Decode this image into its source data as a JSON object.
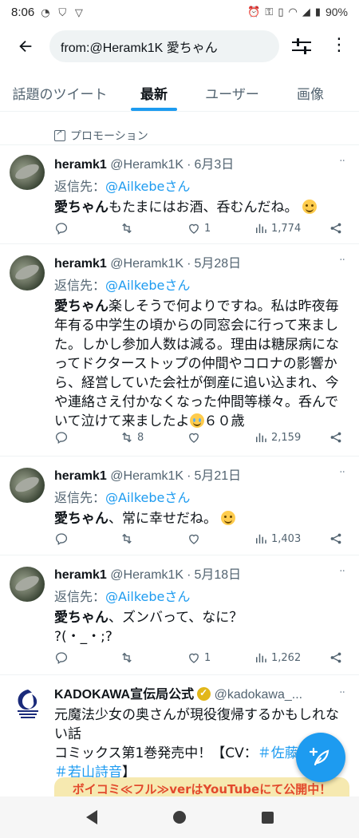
{
  "status_bar": {
    "time": "8:06",
    "battery": "90%"
  },
  "search": {
    "query": "from:@Heramk1K 愛ちゃん"
  },
  "tabs": [
    {
      "label": "話題のツイート",
      "active": false
    },
    {
      "label": "最新",
      "active": true
    },
    {
      "label": "ユーザー",
      "active": false
    },
    {
      "label": "画像",
      "active": false
    }
  ],
  "promo": {
    "label": "プロモーション"
  },
  "tweets": [
    {
      "name": "heramk1",
      "handle": "@Heramk1K",
      "date": "6月3日",
      "reply_prefix": "返信先：",
      "reply_to": "@Ailkebeさん",
      "text_bold": "愛ちゃん",
      "text": "もたまにはお酒、呑むんだね。",
      "likes": "1",
      "retweets": "",
      "views": "1,774"
    },
    {
      "name": "heramk1",
      "handle": "@Heramk1K",
      "date": "5月28日",
      "reply_prefix": "返信先：",
      "reply_to": "@Ailkebeさん",
      "text_bold": "愛ちゃん",
      "text": "楽しそうで何よりですね。私は昨夜毎年有る中学生の頃からの同窓会に行って来ました。しかし参加人数は減る。理由は糖尿病になってドクターストップの仲間やコロナの影響から、経営していた会社が倒産に追い込まれ、今や連絡さえ付かなくなった仲間等様々。呑んでいて泣けて来ましたよ",
      "text_suffix": "６０歳",
      "likes": "",
      "retweets": "8",
      "views": "2,159"
    },
    {
      "name": "heramk1",
      "handle": "@Heramk1K",
      "date": "5月21日",
      "reply_prefix": "返信先：",
      "reply_to": "@Ailkebeさん",
      "text_bold": "愛ちゃん",
      "text": "、常に幸せだね。",
      "likes": "",
      "retweets": "",
      "views": "1,403"
    },
    {
      "name": "heramk1",
      "handle": "@Heramk1K",
      "date": "5月18日",
      "reply_prefix": "返信先：",
      "reply_to": "@Ailkebeさん",
      "text_bold": "愛ちゃん",
      "text": "、ズンバって、なに？",
      "text_line2": "?(・_・;?",
      "likes": "1",
      "retweets": "",
      "views": "1,262"
    }
  ],
  "ad": {
    "name": "KADOKAWA宣伝局公式",
    "handle": "@kadokawa_...",
    "line1": "元魔法少女の奥さんが現役復帰するかもしれない話",
    "line2_prefix": "コミックス第1巻発売中！【CV：",
    "tag1": "＃佐藤",
    "tag2": "＃若山詩音",
    "line3_suffix": "】",
    "banner": "ボイコミ≪フル≫verはYouTubeにて公開中！"
  },
  "colors": {
    "accent": "#1d9bf0",
    "muted": "#536471",
    "text": "#0f1419"
  }
}
